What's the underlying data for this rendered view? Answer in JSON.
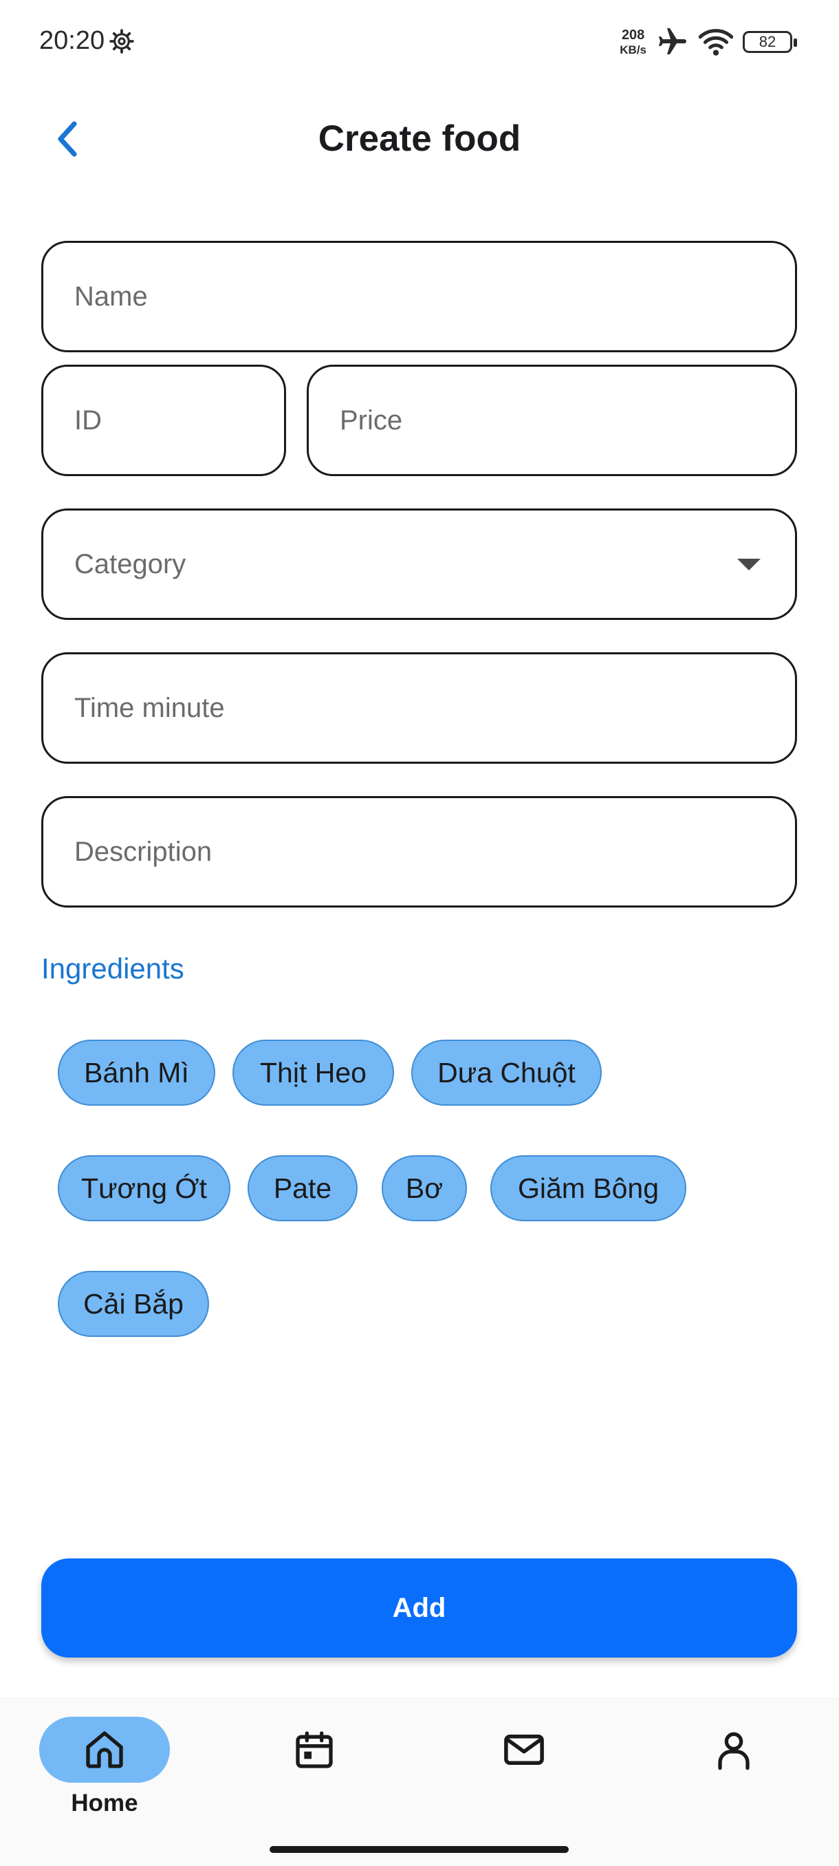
{
  "status_bar": {
    "time": "20:20",
    "net_speed_value": "208",
    "net_speed_unit": "KB/s",
    "battery_level": "82",
    "icons": [
      "settings-gear-icon",
      "airplane-mode-icon",
      "wifi-icon",
      "battery-icon"
    ]
  },
  "header": {
    "title": "Create food",
    "back_icon": "chevron-left-icon"
  },
  "form": {
    "name_placeholder": "Name",
    "id_placeholder": "ID",
    "price_placeholder": "Price",
    "category_placeholder": "Category",
    "time_placeholder": "Time minute",
    "description_placeholder": "Description"
  },
  "ingredients": {
    "title": "Ingredients",
    "chips": [
      "Bánh Mì",
      "Thịt Heo",
      "Dưa Chuột",
      "Tương Ớt",
      "Pate",
      "Bơ",
      "Giăm Bông",
      "Cải Bắp"
    ]
  },
  "add_button_label": "Add",
  "bottom_nav": {
    "items": [
      {
        "label": "Home",
        "icon": "home-icon",
        "active": true
      },
      {
        "label": "",
        "icon": "calendar-icon",
        "active": false
      },
      {
        "label": "",
        "icon": "mail-icon",
        "active": false
      },
      {
        "label": "",
        "icon": "profile-icon",
        "active": false
      }
    ]
  },
  "colors": {
    "accent": "#0a6efd",
    "link_blue": "#1976d2",
    "chip_fill": "#74b8f5",
    "chip_border": "#3f8ed6"
  }
}
